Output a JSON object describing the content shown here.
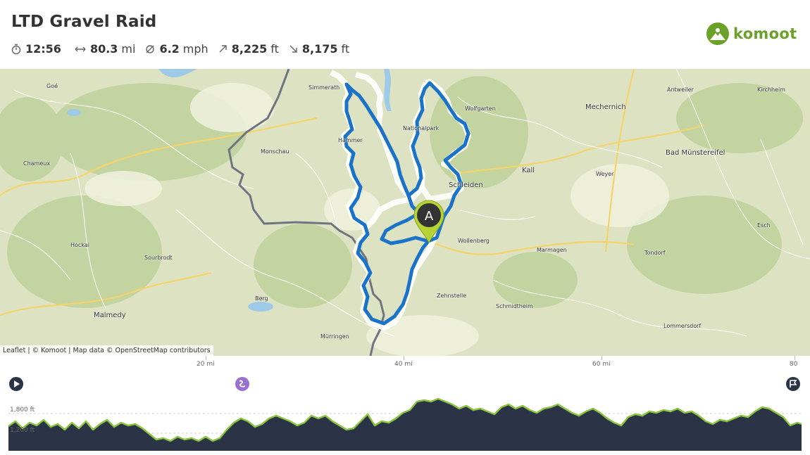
{
  "tour": {
    "title": "LTD Gravel Raid",
    "stats": {
      "duration": "12:56",
      "distance_value": "80.3",
      "distance_unit": "mi",
      "speed_value": "6.2",
      "speed_unit": "mph",
      "uphill_value": "8,225",
      "uphill_unit": "ft",
      "downhill_value": "8,175",
      "downhill_unit": "ft"
    }
  },
  "brand": {
    "name": "komoot",
    "color": "#6aa127"
  },
  "map": {
    "attribution": "Leaflet | © Komoot | Map data © OpenStreetMap contributors",
    "marker_label": "A",
    "route_color": "#1a73c8",
    "places": [
      "Simmerath",
      "Monschau",
      "Goé",
      "Chameux",
      "Hockai",
      "Sourbrodt",
      "Malmedy",
      "Berg",
      "Mürringen",
      "Hammer",
      "Wolfgarten",
      "Schleiden",
      "Kall",
      "Mechernich",
      "Bad Münstereifel",
      "Weyer",
      "Wollenberg",
      "Marmagen",
      "Tondorf",
      "Zehnstelle",
      "Schmidtheim",
      "Lommersdorf",
      "Esch",
      "Antweiler",
      "Kirchheim",
      "Nationalpark"
    ]
  },
  "profile": {
    "distance_labels": [
      "20 mi",
      "40 mi",
      "60 mi",
      "80"
    ],
    "elevation_labels": [
      "1,800 ft",
      "1,200 ft"
    ],
    "fill_color": "#2b3347",
    "line_color": "#8bc53f"
  }
}
